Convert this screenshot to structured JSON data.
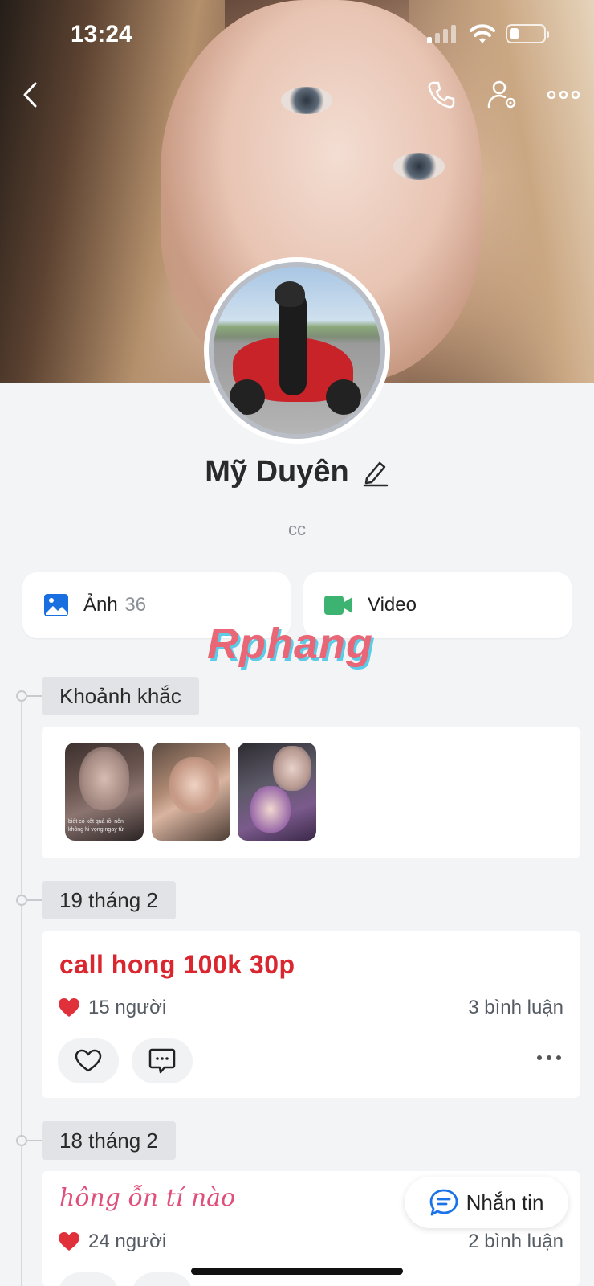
{
  "status_bar": {
    "time": "13:24"
  },
  "profile": {
    "name": "Mỹ Duyên",
    "bio": "cc"
  },
  "media": {
    "photos_label": "Ảnh",
    "photos_count": "36",
    "video_label": "Video"
  },
  "watermark": "Rphang",
  "timeline": {
    "moments_label": "Khoảnh khắc",
    "moment_captions": [
      "biết có kết quả rồi nên",
      "không hi vọng ngay từ"
    ],
    "posts": [
      {
        "date": "19 tháng 2",
        "text": "call hong 100k 30p",
        "likes": "15 người",
        "comments": "3 bình luận"
      },
      {
        "date": "18 tháng 2",
        "text": "hông ỗn tí nào",
        "likes": "24 người",
        "comments": "2 bình luận"
      }
    ]
  },
  "message_button": "Nhắn tin",
  "colors": {
    "accent": "#1a73e8",
    "like": "#e0303a",
    "post_red": "#d9262f",
    "video_green": "#3cb371"
  }
}
